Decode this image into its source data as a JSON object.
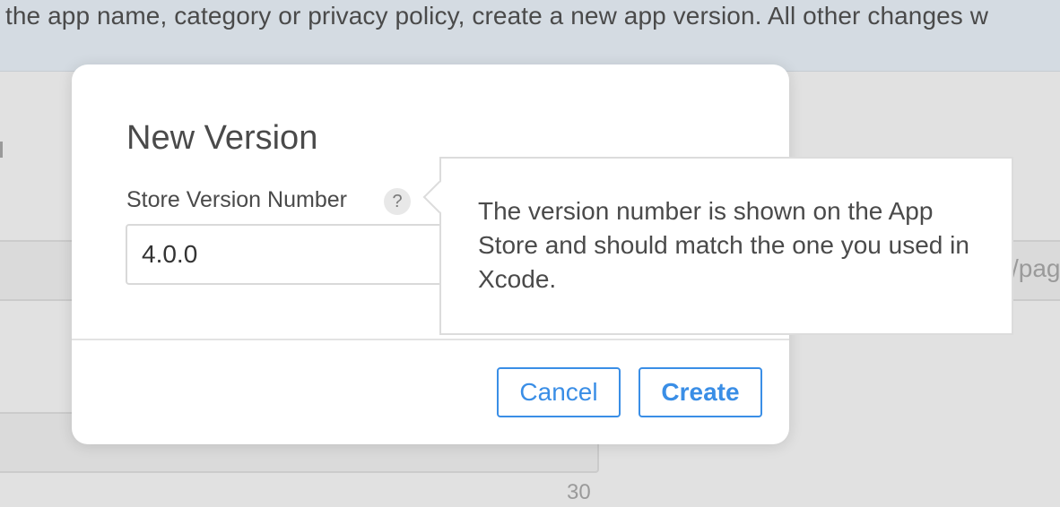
{
  "banner": {
    "text": "the app name, category or privacy policy, create a new app version. All other changes w"
  },
  "background": {
    "url_field_fragment": "/pag",
    "char_counter": "30"
  },
  "dialog": {
    "title": "New Version",
    "field_label": "Store Version Number",
    "help_icon_glyph": "?",
    "version_value": "4.0.0",
    "cancel_label": "Cancel",
    "create_label": "Create"
  },
  "tooltip": {
    "text": "The version number is shown on the App Store and should match the one you used in Xcode."
  },
  "colors": {
    "accent": "#3a8ee6",
    "banner_bg": "#d4dbe2",
    "overlay_bg": "#e1e1e1",
    "text": "#4a4a4a"
  }
}
